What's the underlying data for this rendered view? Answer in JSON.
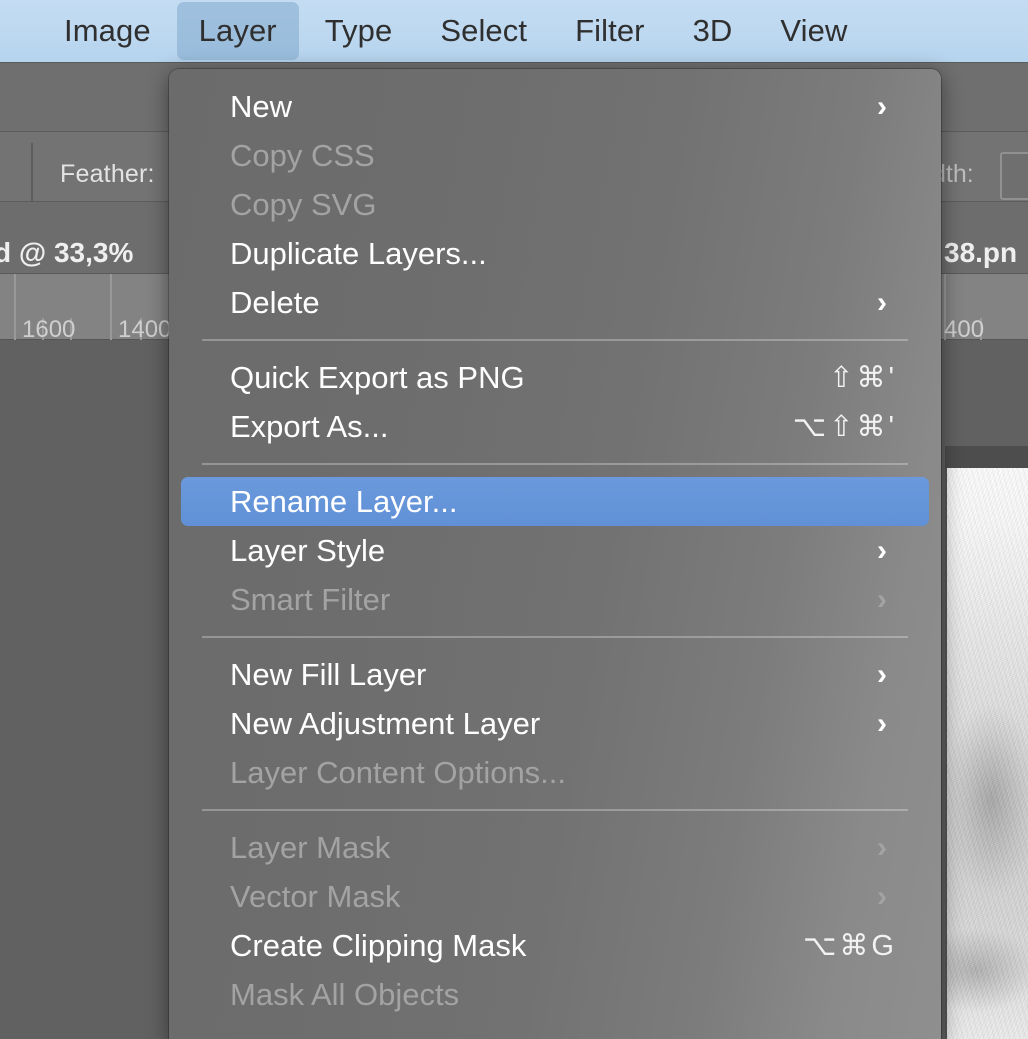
{
  "menubar": {
    "items": [
      {
        "label": "Image",
        "active": false
      },
      {
        "label": "Layer",
        "active": true
      },
      {
        "label": "Type",
        "active": false
      },
      {
        "label": "Select",
        "active": false
      },
      {
        "label": "Filter",
        "active": false
      },
      {
        "label": "3D",
        "active": false
      },
      {
        "label": "View",
        "active": false
      }
    ],
    "background_color": "#bdd8f0",
    "active_highlight_color": "#82aacd"
  },
  "background": {
    "options_bar": {
      "feather_label": "Feather:",
      "width_label": "dth:",
      "width_value": ""
    },
    "document_tab": {
      "title_left": "d @ 33,3%",
      "title_right": "38.pn"
    },
    "ruler": {
      "ticks": [
        "1600",
        "1400",
        "400"
      ]
    },
    "canvas_color": "#616161"
  },
  "menu": {
    "panel_background": "#6f6f6f",
    "highlight_color": "#6190d6",
    "sections": [
      {
        "items": [
          {
            "label": "New",
            "disabled": false,
            "submenu": true,
            "shortcut": ""
          },
          {
            "label": "Copy CSS",
            "disabled": true,
            "submenu": false,
            "shortcut": ""
          },
          {
            "label": "Copy SVG",
            "disabled": true,
            "submenu": false,
            "shortcut": ""
          },
          {
            "label": "Duplicate Layers...",
            "disabled": false,
            "submenu": false,
            "shortcut": ""
          },
          {
            "label": "Delete",
            "disabled": false,
            "submenu": true,
            "shortcut": ""
          }
        ]
      },
      {
        "items": [
          {
            "label": "Quick Export as PNG",
            "disabled": false,
            "submenu": false,
            "shortcut": "⇧⌘'"
          },
          {
            "label": "Export As...",
            "disabled": false,
            "submenu": false,
            "shortcut": "⌥⇧⌘'"
          }
        ]
      },
      {
        "items": [
          {
            "label": "Rename Layer...",
            "disabled": false,
            "submenu": false,
            "shortcut": "",
            "highlighted": true
          },
          {
            "label": "Layer Style",
            "disabled": false,
            "submenu": true,
            "shortcut": ""
          },
          {
            "label": "Smart Filter",
            "disabled": true,
            "submenu": true,
            "shortcut": ""
          }
        ]
      },
      {
        "items": [
          {
            "label": "New Fill Layer",
            "disabled": false,
            "submenu": true,
            "shortcut": ""
          },
          {
            "label": "New Adjustment Layer",
            "disabled": false,
            "submenu": true,
            "shortcut": ""
          },
          {
            "label": "Layer Content Options...",
            "disabled": true,
            "submenu": false,
            "shortcut": ""
          }
        ]
      },
      {
        "items": [
          {
            "label": "Layer Mask",
            "disabled": true,
            "submenu": true,
            "shortcut": ""
          },
          {
            "label": "Vector Mask",
            "disabled": true,
            "submenu": true,
            "shortcut": ""
          },
          {
            "label": "Create Clipping Mask",
            "disabled": false,
            "submenu": false,
            "shortcut": "⌥⌘G"
          },
          {
            "label": "Mask All Objects",
            "disabled": true,
            "submenu": false,
            "shortcut": ""
          }
        ]
      }
    ],
    "submenu_arrow_glyph": "›"
  }
}
